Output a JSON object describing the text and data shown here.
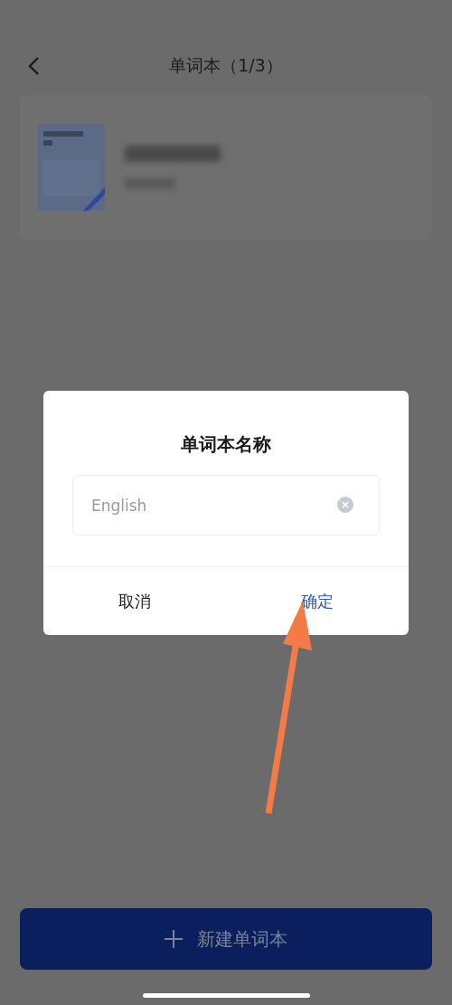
{
  "header": {
    "title": "单词本（1/3）"
  },
  "dialog": {
    "title": "单词本名称",
    "field": {
      "value": "English"
    },
    "buttons": [
      {
        "label": "取消",
        "primary": false
      },
      {
        "label": "确定",
        "primary": true
      }
    ]
  },
  "new_button": {
    "label": "新建单词本"
  }
}
